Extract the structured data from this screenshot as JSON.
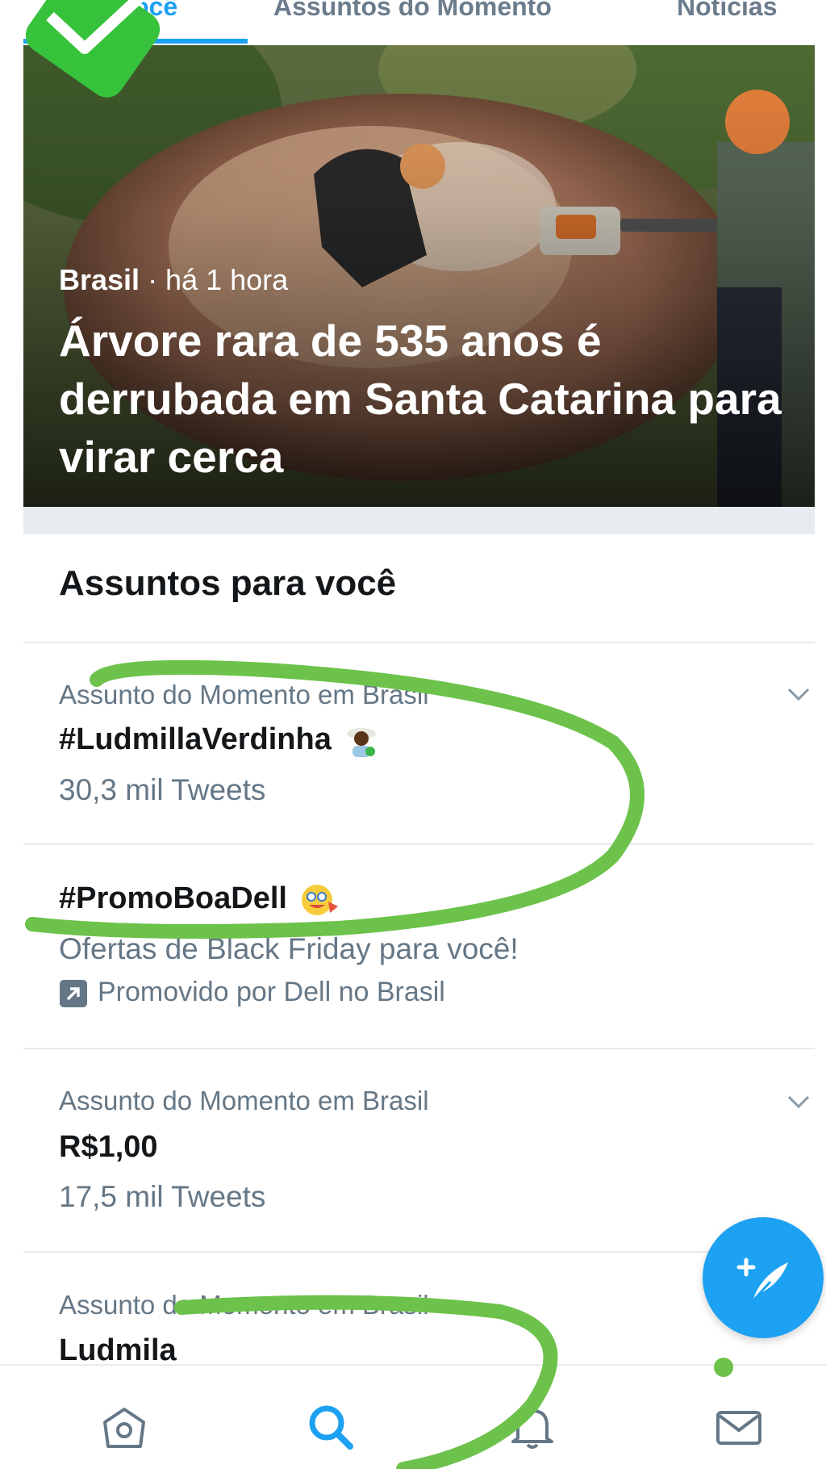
{
  "tabs": [
    {
      "label": "Para você",
      "active": true
    },
    {
      "label": "Assuntos do Momento",
      "active": false
    },
    {
      "label": "Notícias",
      "active": false
    }
  ],
  "hero": {
    "source": "Brasil",
    "time": " · há 1 hora",
    "title": "Árvore rara de 535 anos é derrubada em Santa Catarina para virar cerca"
  },
  "section": {
    "title": "Assuntos para você"
  },
  "trends": [
    {
      "context": "Assunto do Momento em Brasil",
      "name": "#LudmillaVerdinha",
      "count": "30,3 mil Tweets"
    },
    {
      "name": "#PromoBoaDell",
      "description": "Ofertas de Black Friday para você!",
      "promoted": "Promovido por Dell no Brasil"
    },
    {
      "context": "Assunto do Momento em Brasil",
      "name": "R$1,00",
      "count": "17,5 mil Tweets"
    },
    {
      "context": "Assunto do Momento em Brasil",
      "name": "Ludmila"
    }
  ],
  "colors": {
    "accent": "#1da1f2",
    "annotation": "#6cc24a",
    "text_primary": "#14171a",
    "text_secondary": "#657786"
  },
  "icons": {
    "compose": "compose-tweet-icon",
    "home": "home-icon",
    "search": "search-icon",
    "notifications": "bell-icon",
    "messages": "mail-icon"
  }
}
